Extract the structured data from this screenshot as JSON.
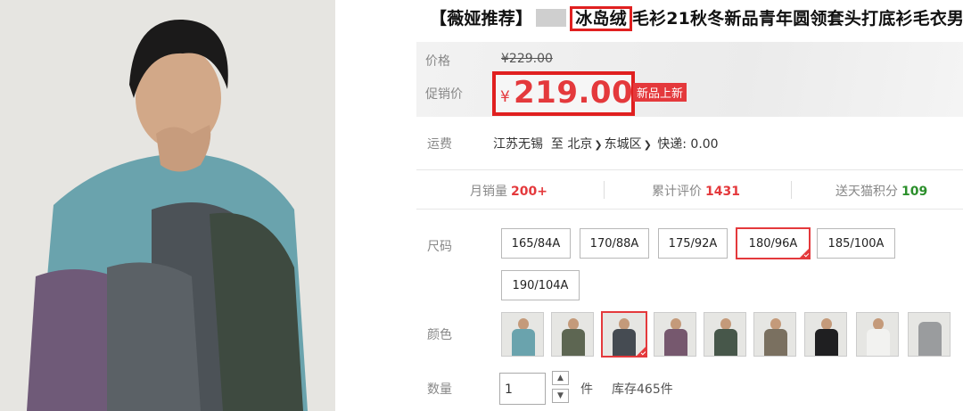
{
  "title": {
    "prefix": "【薇娅推荐】",
    "highlight": "冰岛绒",
    "rest": "毛衫21秋冬新品青年圆领套头打底衫毛衣男"
  },
  "price": {
    "label": "价格",
    "original": "¥229.00",
    "promo_label": "促销价",
    "currency": "¥",
    "value": "219.00",
    "badge": "新品上新"
  },
  "shipping": {
    "label": "运费",
    "origin": "江苏无锡",
    "to": "至",
    "city": "北京",
    "district": "东城区",
    "express": "快递: 0.00"
  },
  "stats": {
    "monthly_label": "月销量",
    "monthly_value": "200+",
    "reviews_label": "累计评价",
    "reviews_value": "1431",
    "points_label": "送天猫积分",
    "points_value": "109"
  },
  "size": {
    "label": "尺码",
    "options": [
      "165/84A",
      "170/88A",
      "175/92A",
      "180/96A",
      "185/100A",
      "190/104A"
    ],
    "selected": "180/96A"
  },
  "color": {
    "label": "颜色",
    "swatches": [
      "light-blue",
      "olive-green",
      "dark-grey",
      "plum",
      "green",
      "khaki",
      "black",
      "white",
      "grey"
    ],
    "selected_index": 2
  },
  "quantity": {
    "label": "数量",
    "value": "1",
    "unit": "件",
    "stock": "库存465件"
  },
  "colors": {
    "accent": "#e4393c",
    "highlight_box": "#e02020",
    "points_green": "#2b8f2b"
  }
}
